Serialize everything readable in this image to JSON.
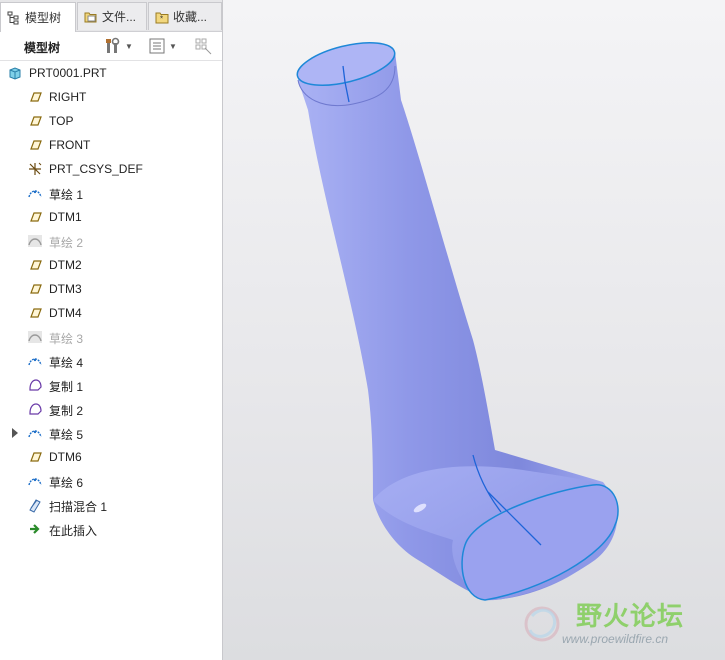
{
  "tabs": [
    {
      "label": "模型树",
      "icon": "model-tree-icon"
    },
    {
      "label": "文件...",
      "icon": "folder-browser-icon"
    },
    {
      "label": "收藏...",
      "icon": "favorites-icon"
    }
  ],
  "toolbar": {
    "title": "模型树"
  },
  "tree": [
    {
      "label": "PRT0001.PRT",
      "icon": "part-icon",
      "dim": false
    },
    {
      "label": "RIGHT",
      "icon": "datum-plane-icon",
      "dim": false
    },
    {
      "label": "TOP",
      "icon": "datum-plane-icon",
      "dim": false
    },
    {
      "label": "FRONT",
      "icon": "datum-plane-icon",
      "dim": false
    },
    {
      "label": "PRT_CSYS_DEF",
      "icon": "coordinate-system-icon",
      "dim": false
    },
    {
      "label": "草绘 1",
      "icon": "sketch-icon",
      "dim": false
    },
    {
      "label": "DTM1",
      "icon": "datum-plane-icon",
      "dim": false
    },
    {
      "label": "草绘 2",
      "icon": "sketch-hidden-icon",
      "dim": true
    },
    {
      "label": "DTM2",
      "icon": "datum-plane-icon",
      "dim": false
    },
    {
      "label": "DTM3",
      "icon": "datum-plane-icon",
      "dim": false
    },
    {
      "label": "DTM4",
      "icon": "datum-plane-icon",
      "dim": false
    },
    {
      "label": "草绘 3",
      "icon": "sketch-hidden-icon",
      "dim": true
    },
    {
      "label": "草绘 4",
      "icon": "sketch-icon",
      "dim": false
    },
    {
      "label": "复制 1",
      "icon": "copy-icon",
      "dim": false
    },
    {
      "label": "复制 2",
      "icon": "copy-icon",
      "dim": false
    },
    {
      "label": "草绘 5",
      "icon": "sketch-icon",
      "dim": false,
      "expandable": true
    },
    {
      "label": "DTM6",
      "icon": "datum-plane-icon",
      "dim": false
    },
    {
      "label": "草绘 6",
      "icon": "sketch-icon",
      "dim": false
    },
    {
      "label": "扫描混合 1",
      "icon": "swept-blend-icon",
      "dim": false
    },
    {
      "label": "在此插入",
      "icon": "insert-here-arrow-icon",
      "dim": false
    }
  ],
  "watermark": {
    "title": "野火论坛",
    "url": "www.proewildfire.cn"
  },
  "colors": {
    "model_fill": "#8e97e6",
    "model_edge": "#1e88d8",
    "viewport_bg": "#ececef",
    "watermark_green": "#8fd06c"
  }
}
